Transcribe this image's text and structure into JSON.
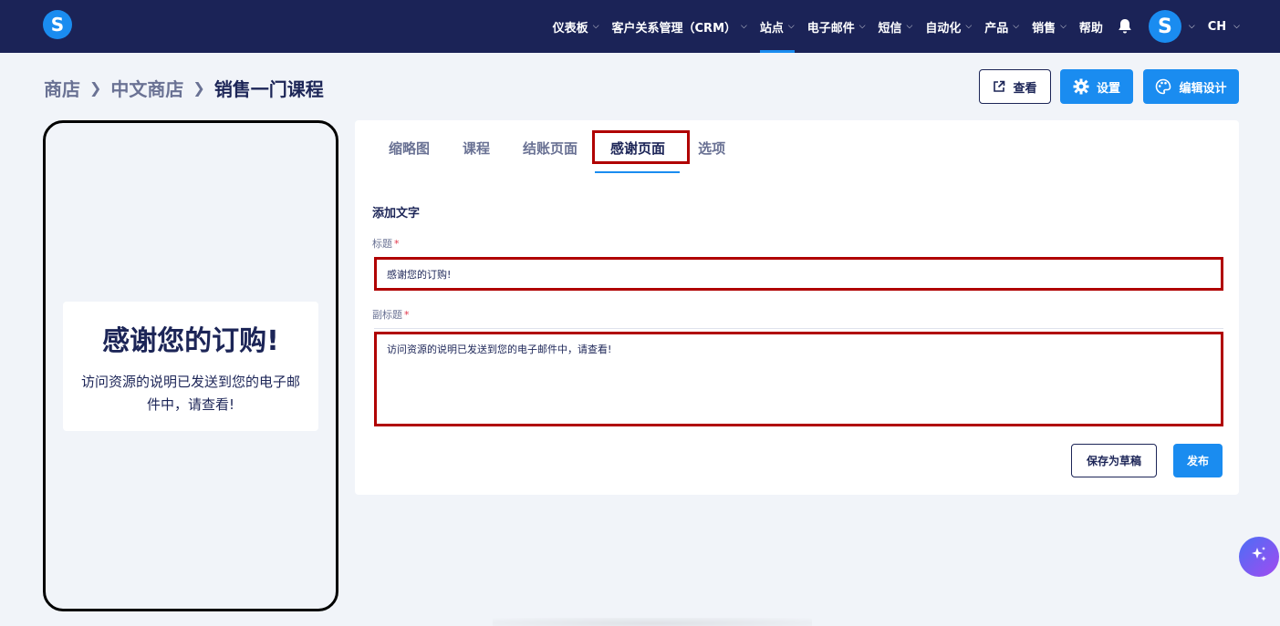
{
  "app": {
    "logo_letter": "S"
  },
  "nav": {
    "items": [
      {
        "label": "仪表板",
        "has_menu": true,
        "active": false
      },
      {
        "label": "客户关系管理（CRM）",
        "has_menu": true,
        "active": false
      },
      {
        "label": "站点",
        "has_menu": true,
        "active": true
      },
      {
        "label": "电子邮件",
        "has_menu": true,
        "active": false
      },
      {
        "label": "短信",
        "has_menu": true,
        "active": false
      },
      {
        "label": "自动化",
        "has_menu": true,
        "active": false
      },
      {
        "label": "产品",
        "has_menu": true,
        "active": false
      },
      {
        "label": "销售",
        "has_menu": true,
        "active": false
      },
      {
        "label": "帮助",
        "has_menu": false,
        "active": false
      }
    ],
    "avatar_letter": "S",
    "language": "CH",
    "icons": {
      "bell": "bell-icon",
      "chevron": "chevron-down-icon"
    }
  },
  "breadcrumb": [
    "商店",
    "中文商店",
    "销售一门课程"
  ],
  "actions": {
    "view_label": "查看",
    "settings_label": "设置",
    "design_label": "编辑设计"
  },
  "preview": {
    "title": "感谢您的订购!",
    "subtitle": "访问资源的说明已发送到您的电子邮件中，请查看!"
  },
  "tabs": [
    {
      "label": "缩略图",
      "active": false
    },
    {
      "label": "课程",
      "active": false
    },
    {
      "label": "结账页面",
      "active": false
    },
    {
      "label": "感谢页面",
      "active": true
    },
    {
      "label": "选项",
      "active": false
    }
  ],
  "form": {
    "section_title": "添加文字",
    "title_label": "标题",
    "title_value": "感谢您的订购!",
    "subtitle_label": "副标题",
    "subtitle_value": "访问资源的说明已发送到您的电子邮件中，请查看!",
    "required_mark": "*",
    "save_draft_label": "保存为草稿",
    "publish_label": "发布"
  },
  "colors": {
    "nav_bg": "#1b2357",
    "accent": "#1a8cf0",
    "text_dark": "#1c2557",
    "text_muted": "#6a7294",
    "highlight_red": "#b00000",
    "page_bg": "#f1f4f9"
  }
}
